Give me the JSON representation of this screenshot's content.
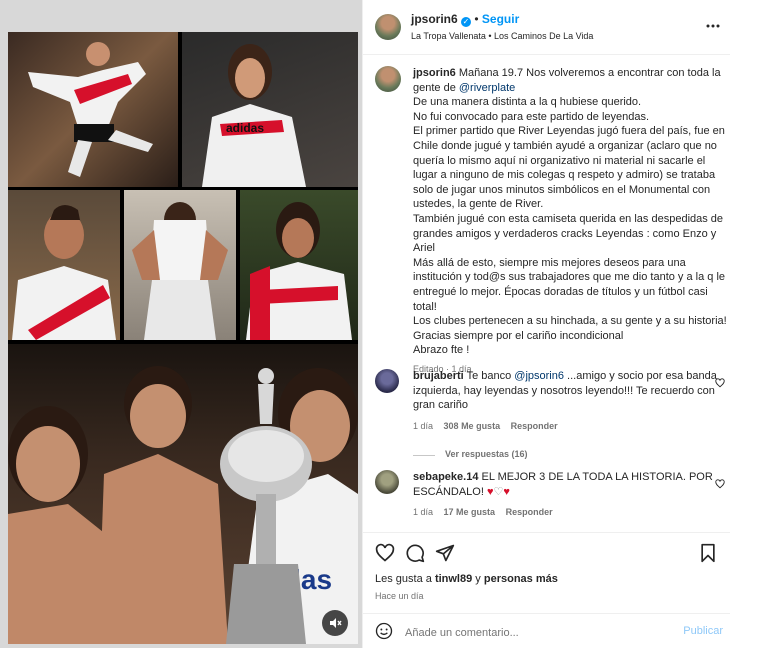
{
  "post": {
    "author": "jpsorin6",
    "follow_label": "Seguir",
    "music": "La Tropa Vallenata • Los Caminos De La Vida"
  },
  "caption": {
    "author": "jpsorin6",
    "lines": [
      "Mañana 19.7 Nos volveremos a encontrar con toda la",
      "De una manera distinta a la q hubiese querido.",
      "No fui convocado para este partido de leyendas.",
      "El primer partido que River Leyendas jugó fuera del país, fue en",
      "Chile donde jugué y también ayudé a organizar (aclaro que no",
      "quería lo mismo aquí ni organizativo ni material ni sacarle el",
      "lugar a ninguno de mis colegas q respeto y admiro) se trataba",
      "solo de jugar unos minutos simbólicos en el Monumental con",
      "ustedes, la gente de River.",
      "También jugué con esta camiseta querida en las despedidas de",
      "grandes amigos y verdaderos cracks Leyendas : como Enzo y",
      "Ariel",
      "Más allá de esto, siempre mis mejores deseos para una",
      "institución y tod@s sus trabajadores que me dio tanto y a la q le",
      "entregué lo mejor. Épocas doradas de títulos y un fútbol casi",
      "total!",
      "Los clubes pertenecen a su hinchada, a su gente y a su historia!",
      "Gracias siempre por el cariño incondicional",
      "Abrazo fte !"
    ],
    "line2_prefix": "gente de ",
    "line2_mention": "@riverplate",
    "edited": "Editado · 1 día"
  },
  "comments": [
    {
      "author": "brujaberti",
      "lead": "Te banco ",
      "mention": "@jpsorin6",
      "rest": " ...amigo y socio por esa banda",
      "lines": [
        "izquierda, hay leyendas y nosotros leyendo!!! Te recuerdo con",
        "gran cariño"
      ],
      "time": "1 día",
      "likes": "308 Me gusta",
      "reply": "Responder",
      "view_replies": "Ver respuestas (16)"
    },
    {
      "author": "sebapeke.14",
      "first": "EL MEJOR 3 DE LA TODA LA HISTORIA. POR",
      "second": "ESCÁNDALO! ",
      "time": "1 día",
      "likes": "17 Me gusta",
      "reply": "Responder"
    }
  ],
  "likes": {
    "prefix": "Les gusta a ",
    "user": "tinwl89",
    "mid": " y ",
    "others": "personas más"
  },
  "date": "Hace un día",
  "comment_box": {
    "placeholder": "Añade un comentario...",
    "publish": "Publicar"
  },
  "colors": {
    "link": "#00376b",
    "accent": "#0095f6",
    "river_red": "#d6102b",
    "verified": "#0095f6"
  },
  "icons": [
    "more-icon",
    "heart-icon",
    "comment-icon",
    "share-icon",
    "bookmark-icon",
    "emoji-icon",
    "mute-icon",
    "verified-icon"
  ]
}
